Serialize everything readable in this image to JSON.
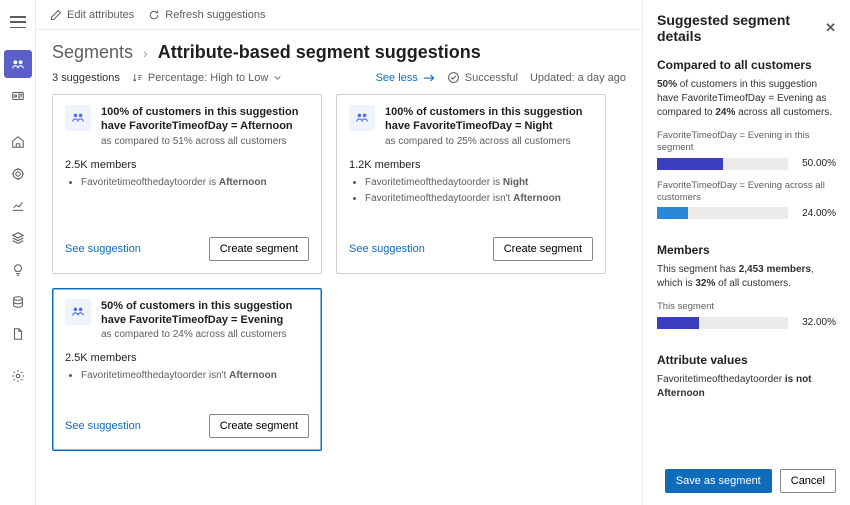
{
  "topbar": {
    "edit": "Edit attributes",
    "refresh": "Refresh suggestions"
  },
  "breadcrumb": {
    "parent": "Segments",
    "title": "Attribute-based segment suggestions"
  },
  "meta": {
    "count": "3 suggestions",
    "sort": "Percentage: High to Low",
    "seeless": "See less",
    "status": "Successful",
    "updated": "Updated: a day ago"
  },
  "card1": {
    "t1": "100% of customers in this suggestion have FavoriteTimeofDay = Afternoon",
    "t2": "as compared to 51% across all customers",
    "members": "2.5K members",
    "b1a": "Favoritetimeofthedaytoorder is ",
    "b1b": "Afternoon"
  },
  "card2": {
    "t1": "100% of customers in this suggestion have FavoriteTimeofDay = Night",
    "t2": "as compared to 25% across all customers",
    "members": "1.2K members",
    "b1a": "Favoritetimeofthedaytoorder is ",
    "b1b": "Night",
    "b2a": "Favoritetimeofthedaytoorder isn't ",
    "b2b": "Afternoon"
  },
  "card3": {
    "t1": "50% of customers in this suggestion have FavoriteTimeofDay = Evening",
    "t2": "as compared to 24% across all customers",
    "members": "2.5K members",
    "b1a": "Favoritetimeofthedaytoorder isn't ",
    "b1b": "Afternoon"
  },
  "common": {
    "see": "See suggestion",
    "create": "Create segment"
  },
  "panel": {
    "title": "Suggested segment details",
    "comp_h": "Compared to all customers",
    "comp_p_a": "50%",
    "comp_p_b": " of customers in this suggestion have FavoriteTimeofDay = Evening as compared to ",
    "comp_p_c": "24%",
    "comp_p_d": " across all customers.",
    "bar1_lbl": "FavoriteTimeofDay = Evening in this segment",
    "bar1_val": "50.00%",
    "bar1_w": "50%",
    "bar2_lbl": "FavoriteTimeofDay = Evening across all customers",
    "bar2_val": "24.00%",
    "bar2_w": "24%",
    "mem_h": "Members",
    "mem_p_a": "This segment has ",
    "mem_p_b": "2,453 members",
    "mem_p_c": ", which is ",
    "mem_p_d": "32%",
    "mem_p_e": " of all customers.",
    "bar3_lbl": "This segment",
    "bar3_val": "32.00%",
    "bar3_w": "32%",
    "attr_h": "Attribute values",
    "attr_p_a": "Favoritetimeofthedaytoorder ",
    "attr_p_b": "is not Afternoon",
    "save": "Save as segment",
    "cancel": "Cancel"
  }
}
